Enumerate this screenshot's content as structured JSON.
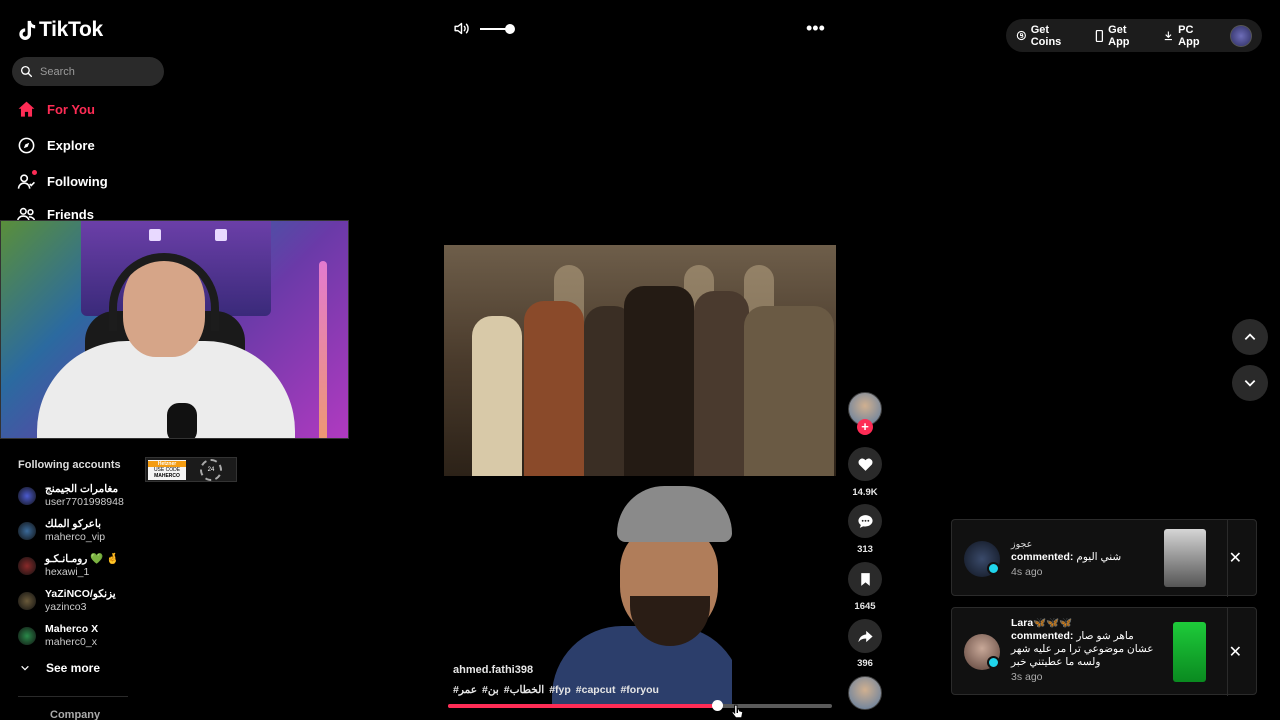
{
  "app": {
    "name": "TikTok"
  },
  "search": {
    "placeholder": "Search"
  },
  "nav": [
    {
      "label": "For You"
    },
    {
      "label": "Explore"
    },
    {
      "label": "Following"
    },
    {
      "label": "Friends"
    }
  ],
  "following_accounts": {
    "title": "Following accounts",
    "items": [
      {
        "display": "مغامرات الجيمنج",
        "handle": "user7701998948",
        "color": "#4c5bd0"
      },
      {
        "display": "باعركو الملك",
        "handle": "maherco_vip",
        "color": "#3a6a9a"
      },
      {
        "display": "رومـانـكـو 💚 🤞",
        "handle": "hexawi_1",
        "color": "#8a2a2a"
      },
      {
        "display": "YaZiNCO/يزنكو",
        "handle": "yazinco3",
        "color": "#6a5a3a"
      },
      {
        "display": "Maherco X",
        "handle": "maherc0_x",
        "color": "#2a8a4a"
      }
    ],
    "see_more": "See more"
  },
  "promo": {
    "top": "Hetzner",
    "mid": "USE CODE",
    "bottom": "MAHERCO",
    "ring": "24"
  },
  "footer": {
    "company": "Company"
  },
  "topbar": {
    "get_coins": "Get Coins",
    "get_app": "Get App",
    "pc_app": "PC App"
  },
  "player": {
    "volume_level": 1.0,
    "progress": 0.7
  },
  "video": {
    "username": "ahmed.fathi398",
    "hashtags": [
      "#عمر",
      "#بن",
      "#الخطاب",
      "#fyp",
      "#capcut",
      "#foryou"
    ]
  },
  "actions": {
    "likes": "14.9K",
    "comments": "313",
    "saves": "1645",
    "shares": "396"
  },
  "notifications": [
    {
      "name": "عجوز",
      "verb": "commented:",
      "message": "شني اليوم",
      "time": "4s ago"
    },
    {
      "name": "Lara🦋🦋🦋",
      "verb": "commented:",
      "message_line1": "ماهر شو صار",
      "message_line2": "عشان موضوعي ترا مر عليه شهر",
      "message_line3": "ولسه ما عطيتني خبر",
      "time": "3s ago"
    }
  ],
  "colors": {
    "accent": "#fe2c55",
    "verified": "#20d5ec"
  }
}
